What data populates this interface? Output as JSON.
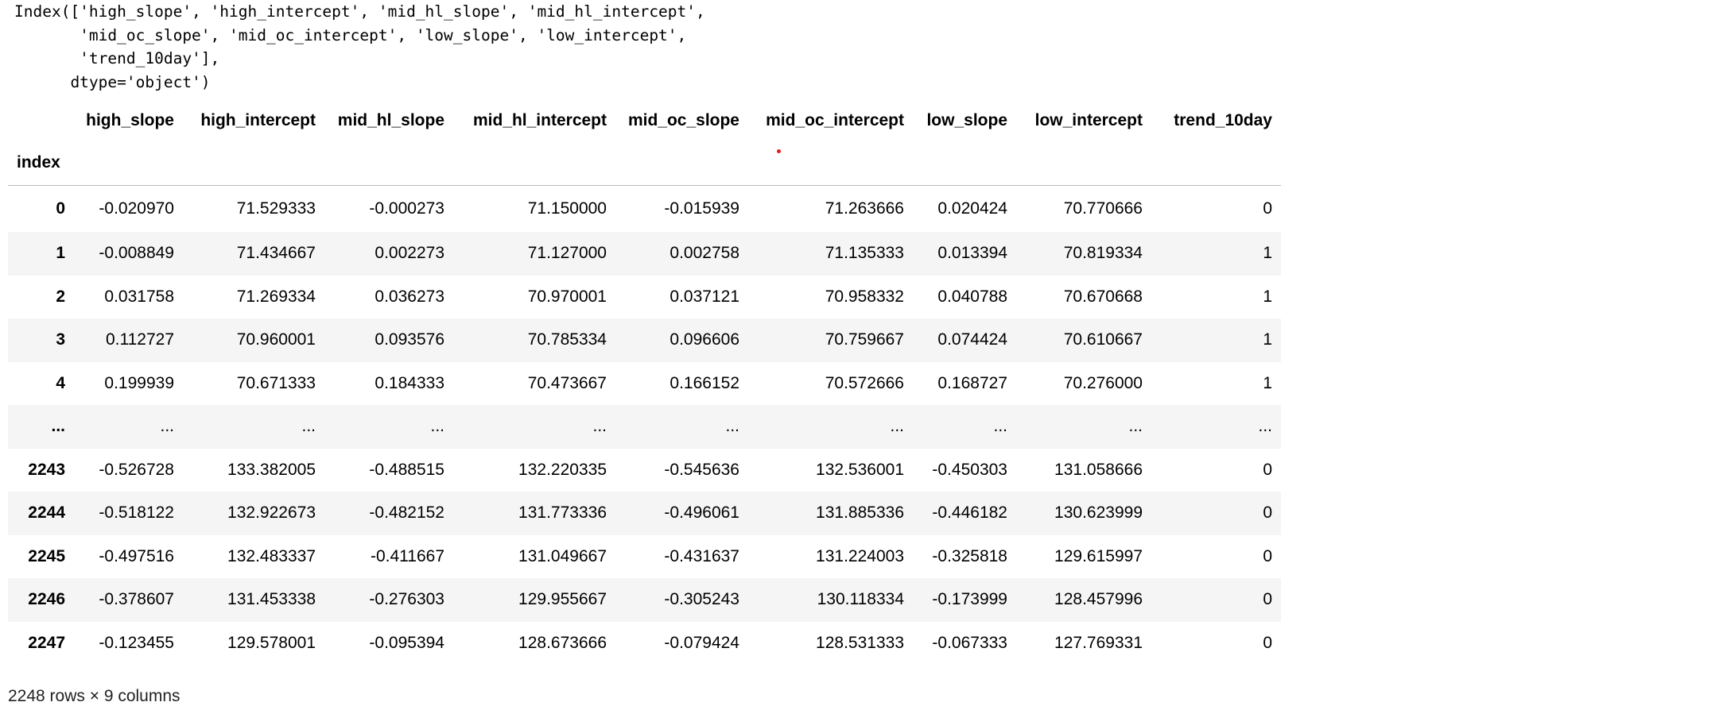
{
  "code_output": {
    "lines": [
      "Index(['high_slope', 'high_intercept', 'mid_hl_slope', 'mid_hl_intercept',",
      "       'mid_oc_slope', 'mid_oc_intercept', 'low_slope', 'low_intercept',",
      "       'trend_10day'],",
      "      dtype='object')"
    ]
  },
  "dataframe": {
    "columns": [
      "high_slope",
      "high_intercept",
      "mid_hl_slope",
      "mid_hl_intercept",
      "mid_oc_slope",
      "mid_oc_intercept",
      "low_slope",
      "low_intercept",
      "trend_10day"
    ],
    "index_name": "index",
    "rows": [
      {
        "index": "0",
        "values": [
          "-0.020970",
          "71.529333",
          "-0.000273",
          "71.150000",
          "-0.015939",
          "71.263666",
          "0.020424",
          "70.770666",
          "0"
        ]
      },
      {
        "index": "1",
        "values": [
          "-0.008849",
          "71.434667",
          "0.002273",
          "71.127000",
          "0.002758",
          "71.135333",
          "0.013394",
          "70.819334",
          "1"
        ]
      },
      {
        "index": "2",
        "values": [
          "0.031758",
          "71.269334",
          "0.036273",
          "70.970001",
          "0.037121",
          "70.958332",
          "0.040788",
          "70.670668",
          "1"
        ]
      },
      {
        "index": "3",
        "values": [
          "0.112727",
          "70.960001",
          "0.093576",
          "70.785334",
          "0.096606",
          "70.759667",
          "0.074424",
          "70.610667",
          "1"
        ]
      },
      {
        "index": "4",
        "values": [
          "0.199939",
          "70.671333",
          "0.184333",
          "70.473667",
          "0.166152",
          "70.572666",
          "0.168727",
          "70.276000",
          "1"
        ]
      },
      {
        "index": "...",
        "values": [
          "...",
          "...",
          "...",
          "...",
          "...",
          "...",
          "...",
          "...",
          "..."
        ]
      },
      {
        "index": "2243",
        "values": [
          "-0.526728",
          "133.382005",
          "-0.488515",
          "132.220335",
          "-0.545636",
          "132.536001",
          "-0.450303",
          "131.058666",
          "0"
        ]
      },
      {
        "index": "2244",
        "values": [
          "-0.518122",
          "132.922673",
          "-0.482152",
          "131.773336",
          "-0.496061",
          "131.885336",
          "-0.446182",
          "130.623999",
          "0"
        ]
      },
      {
        "index": "2245",
        "values": [
          "-0.497516",
          "132.483337",
          "-0.411667",
          "131.049667",
          "-0.431637",
          "131.224003",
          "-0.325818",
          "129.615997",
          "0"
        ]
      },
      {
        "index": "2246",
        "values": [
          "-0.378607",
          "131.453338",
          "-0.276303",
          "129.955667",
          "-0.305243",
          "130.118334",
          "-0.173999",
          "128.457996",
          "0"
        ]
      },
      {
        "index": "2247",
        "values": [
          "-0.123455",
          "129.578001",
          "-0.095394",
          "128.673666",
          "-0.079424",
          "128.531333",
          "-0.067333",
          "127.769331",
          "0"
        ]
      }
    ],
    "summary": "2248 rows × 9 columns",
    "stripe_color": "#f5f5f5",
    "border_color": "#bdbdbd",
    "marker_color": "#e41b1b"
  }
}
